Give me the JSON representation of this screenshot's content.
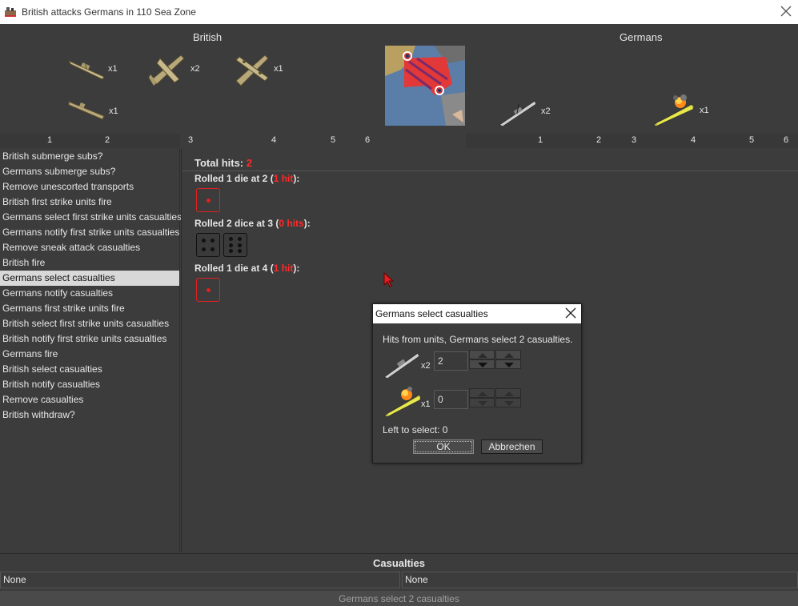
{
  "window": {
    "title": "British attacks Germans in 110 Sea Zone",
    "icon": "game-app-icon",
    "close_icon": "close-icon"
  },
  "attacker": {
    "name": "British",
    "units": [
      {
        "type": "battleship",
        "icon": "battleship-icon",
        "count": "x1"
      },
      {
        "type": "fighter",
        "icon": "fighter-plane-icon",
        "count": "x2"
      },
      {
        "type": "bomber",
        "icon": "bomber-plane-icon",
        "count": "x1"
      },
      {
        "type": "submarine",
        "icon": "submarine-icon",
        "count": "x1"
      }
    ],
    "scale": [
      "1",
      "2",
      "3",
      "4",
      "5",
      "6"
    ]
  },
  "defender": {
    "name": "Germans",
    "units": [
      {
        "type": "cruiser",
        "icon": "cruiser-ship-icon",
        "count": "x2"
      },
      {
        "type": "damaged carrier",
        "icon": "burning-ship-icon",
        "count": "x1"
      }
    ],
    "scale": [
      "1",
      "2",
      "3",
      "4",
      "5",
      "6"
    ]
  },
  "steps": [
    "British submerge subs?",
    "Germans submerge subs?",
    "Remove unescorted transports",
    "British first strike units fire",
    "Germans select first strike units casualties",
    "Germans notify first strike units casualties",
    "Remove sneak attack casualties",
    "British fire",
    "Germans select casualties",
    "Germans notify casualties",
    "Germans first strike units fire",
    "British select first strike units casualties",
    "British notify first strike units casualties",
    "Germans fire",
    "British select casualties",
    "British notify casualties",
    "Remove casualties",
    "British withdraw?"
  ],
  "selected_step": "Germans select casualties",
  "results": {
    "total_label": "Total hits:",
    "total_value": "2",
    "rolls": [
      {
        "pre": "Rolled 1 die at 2 (",
        "hit": "1 hit",
        "post": "):",
        "dice": [
          1
        ],
        "hits": [
          true
        ]
      },
      {
        "pre": "Rolled 2 dice at 3 (",
        "hit": "0 hits",
        "post": "):",
        "dice": [
          4,
          6
        ],
        "hits": [
          false,
          false
        ]
      },
      {
        "pre": "Rolled 1 die at 4 (",
        "hit": "1 hit",
        "post": "):",
        "dice": [
          1
        ],
        "hits": [
          true
        ]
      }
    ]
  },
  "dialog": {
    "title": "Germans select casualties",
    "message": "Hits from units,  Germans select 2 casualties.",
    "rows": [
      {
        "icon": "cruiser-ship-icon",
        "count": "x2",
        "value": "2"
      },
      {
        "icon": "burning-ship-icon",
        "count": "x1",
        "value": "0"
      }
    ],
    "left_to_select": "Left to select: 0",
    "ok_label": "OK",
    "cancel_label": "Abbrechen"
  },
  "casualties": {
    "header": "Casualties",
    "attacker_value": "None",
    "defender_value": "None"
  },
  "status": "Germans select 2 casualties",
  "colors": {
    "background": "#3c3c3c",
    "hit_red": "#ff2a2a",
    "selected_row": "#d8d8d8"
  }
}
